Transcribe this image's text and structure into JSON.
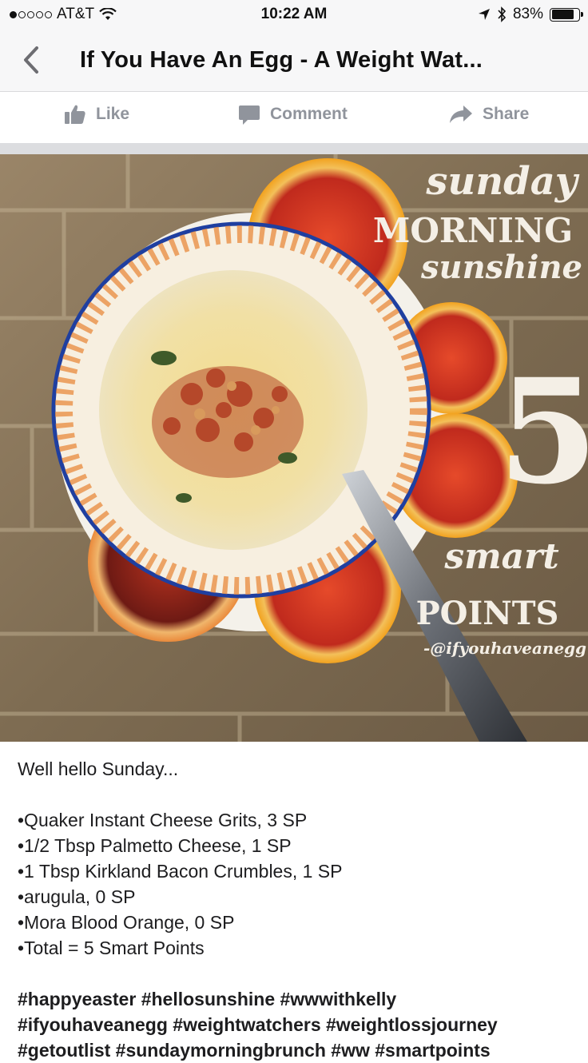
{
  "status_bar": {
    "carrier": "AT&T",
    "time": "10:22 AM",
    "battery": "83%",
    "battery_level": 0.83
  },
  "nav": {
    "title": "If You Have An Egg - A Weight Wat..."
  },
  "actions": {
    "like": "Like",
    "comment": "Comment",
    "share": "Share"
  },
  "photo": {
    "overlay_line1": "sunday",
    "overlay_line2": "MORNING",
    "overlay_line3": "sunshine",
    "overlay_number": "5",
    "overlay_line4": "smart",
    "overlay_line5": "POINTS",
    "overlay_credit": "-@ifyouhaveanegg"
  },
  "caption": {
    "greeting": "Well hello Sunday...",
    "items": [
      "•Quaker Instant Cheese Grits, 3 SP",
      "•1/2 Tbsp Palmetto Cheese, 1 SP",
      "•1 Tbsp Kirkland Bacon Crumbles, 1 SP",
      "•arugula, 0 SP",
      "•Mora Blood Orange, 0 SP",
      "•Total = 5 Smart Points"
    ],
    "hashtags_line1": "#happyeaster #hellosunshine #wwwithkelly",
    "hashtags_line2": "#ifyouhaveanegg #weightwatchers #weightlossjourney",
    "hashtags_line3": "#getoutlist #sundaymorningbrunch #ww #smartpoints"
  },
  "colors": {
    "chrome_bg": "#f7f7f8",
    "action_gray": "#90949c",
    "bowl_blue": "#1f3fa0",
    "orange_rind": "#f2a21f",
    "blood_orange": "#c8281e"
  }
}
